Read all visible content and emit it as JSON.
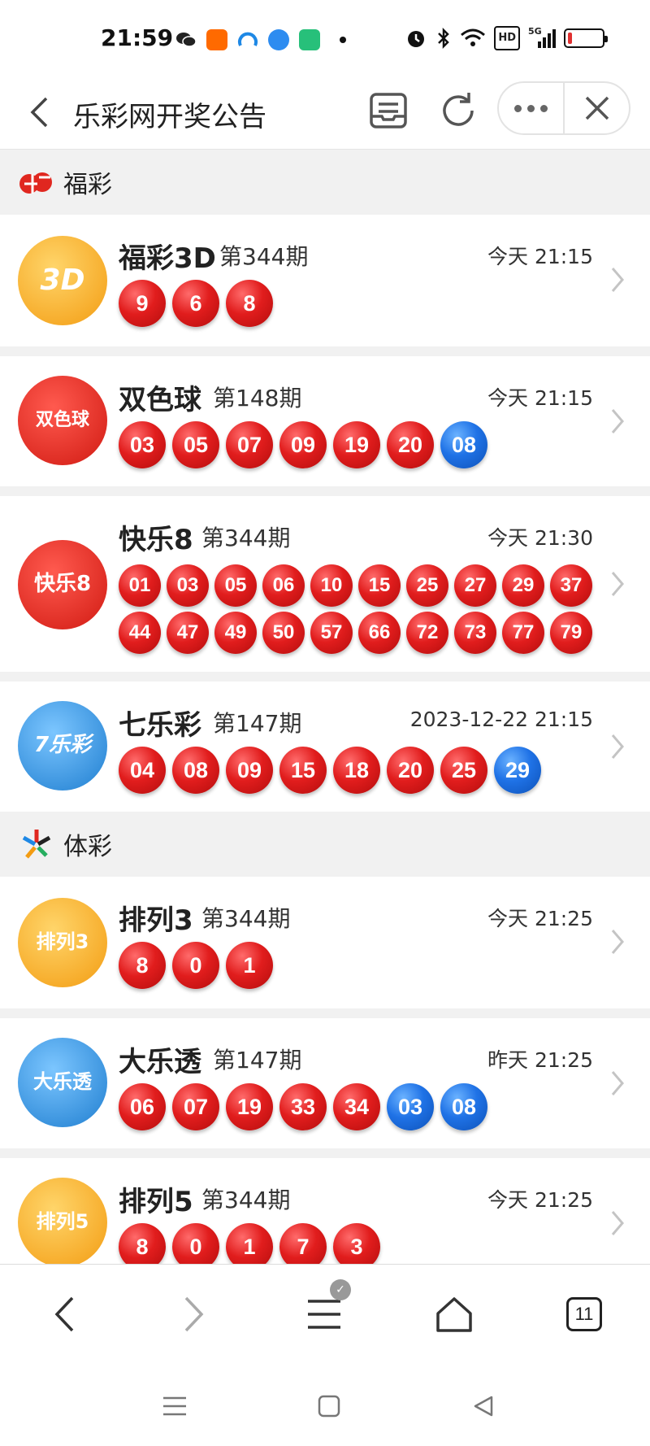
{
  "status_bar": {
    "time": "21:59",
    "signal_label": "5G",
    "hd_label": "HD",
    "battery_level": 0.12
  },
  "title_bar": {
    "title": "乐彩网开奖公告"
  },
  "sections": [
    {
      "label": "福彩",
      "rows": [
        {
          "name": "福彩3D",
          "issue": "第344期",
          "time": "今天 21:15",
          "logo_text": "3D",
          "logo_color": "#f7a21b",
          "numbers": [
            "9",
            "6",
            "8"
          ],
          "blue": []
        },
        {
          "name": "双色球",
          "issue": "第148期",
          "time": "今天 21:15",
          "logo_text": "双色球",
          "logo_color": "#e0271f",
          "numbers": [
            "03",
            "05",
            "07",
            "09",
            "19",
            "20"
          ],
          "blue": [
            "08"
          ]
        },
        {
          "name": "快乐8",
          "issue": "第344期",
          "time": "今天 21:30",
          "logo_text": "快乐8",
          "logo_color": "#e02a22",
          "numbers": [
            "01",
            "03",
            "05",
            "06",
            "10",
            "15",
            "25",
            "27",
            "29",
            "37",
            "44",
            "47",
            "49",
            "50",
            "57",
            "66",
            "72",
            "73",
            "77",
            "79"
          ],
          "blue": []
        },
        {
          "name": "七乐彩",
          "issue": "第147期",
          "time": "2023-12-22 21:15",
          "logo_text": "7乐彩",
          "logo_color": "#2a8fd8",
          "numbers": [
            "04",
            "08",
            "09",
            "15",
            "18",
            "20",
            "25"
          ],
          "blue": [
            "29"
          ]
        }
      ]
    },
    {
      "label": "体彩",
      "rows": [
        {
          "name": "排列3",
          "issue": "第344期",
          "time": "今天 21:25",
          "logo_text": "排列3",
          "logo_color": "#f6a31c",
          "numbers": [
            "8",
            "0",
            "1"
          ],
          "blue": []
        },
        {
          "name": "大乐透",
          "issue": "第147期",
          "time": "昨天 21:25",
          "logo_text": "大乐透",
          "logo_color": "#2f86d6",
          "numbers": [
            "06",
            "07",
            "19",
            "33",
            "34"
          ],
          "blue": [
            "03",
            "08"
          ]
        },
        {
          "name": "排列5",
          "issue": "第344期",
          "time": "今天 21:25",
          "logo_text": "排列5",
          "logo_color": "#f6a31c",
          "numbers": [
            "8",
            "0",
            "1",
            "7",
            "3"
          ],
          "blue": []
        }
      ]
    }
  ],
  "bottom_nav": {
    "tabs_count": "11"
  }
}
